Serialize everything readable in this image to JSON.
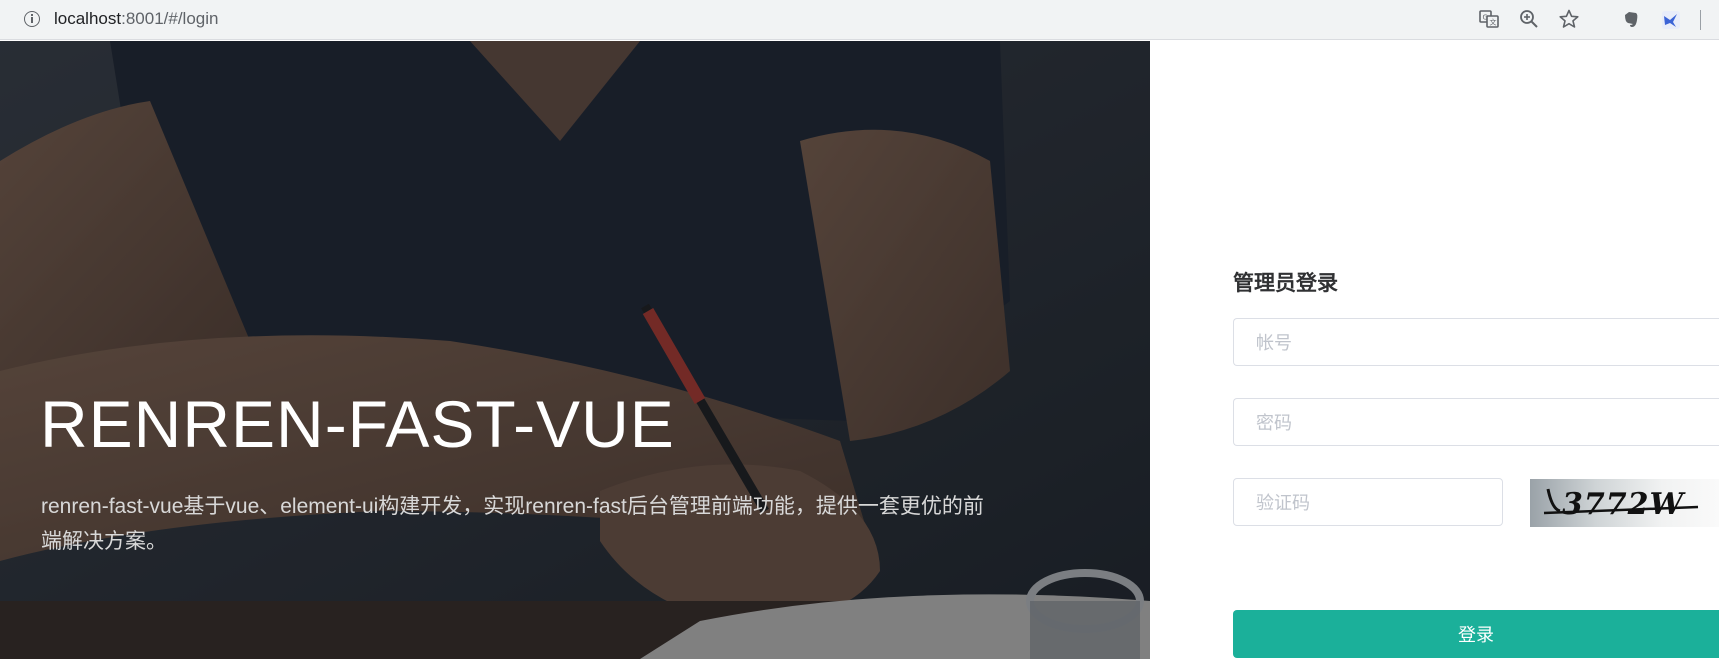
{
  "browser": {
    "url_host": "localhost",
    "url_rest": ":8001/#/login",
    "icons": [
      "info-icon",
      "translate-icon",
      "zoom-icon",
      "star-icon",
      "evernote-icon",
      "bird-extension-icon"
    ]
  },
  "hero": {
    "title": "RENREN-FAST-VUE",
    "description": "renren-fast-vue基于vue、element-ui构建开发，实现renren-fast后台管理前端功能，提供一套更优的前端解决方案。"
  },
  "login": {
    "title": "管理员登录",
    "username_placeholder": "帐号",
    "password_placeholder": "密码",
    "captcha_placeholder": "验证码",
    "captcha_text": "3772W",
    "submit_label": "登录"
  },
  "colors": {
    "accent": "#1bb09a",
    "hero_overlay": "#2a2f37"
  }
}
